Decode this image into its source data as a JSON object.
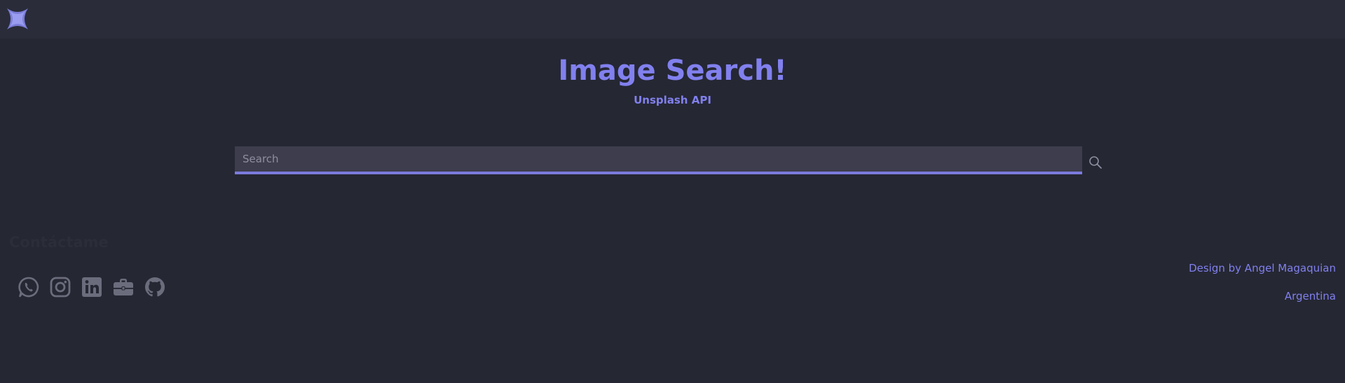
{
  "header": {
    "logo_icon": "star-logo-icon"
  },
  "main": {
    "title": "Image Search!",
    "subtitle": "Unsplash API",
    "search": {
      "placeholder": "Search",
      "value": "",
      "button_icon": "search-icon"
    }
  },
  "contact": {
    "heading": "Contáctame",
    "links": [
      {
        "icon": "whatsapp-icon"
      },
      {
        "icon": "instagram-icon"
      },
      {
        "icon": "linkedin-icon"
      },
      {
        "icon": "briefcase-icon"
      },
      {
        "icon": "github-icon"
      }
    ]
  },
  "footer": {
    "credit": "Design by Angel Magaquian",
    "country": "Argentina"
  },
  "colors": {
    "background": "#252733",
    "topbar": "#2a2c39",
    "accent": "#8180ee",
    "input_bg": "#3d3d4d",
    "icon_gray": "#6b6c7c"
  }
}
